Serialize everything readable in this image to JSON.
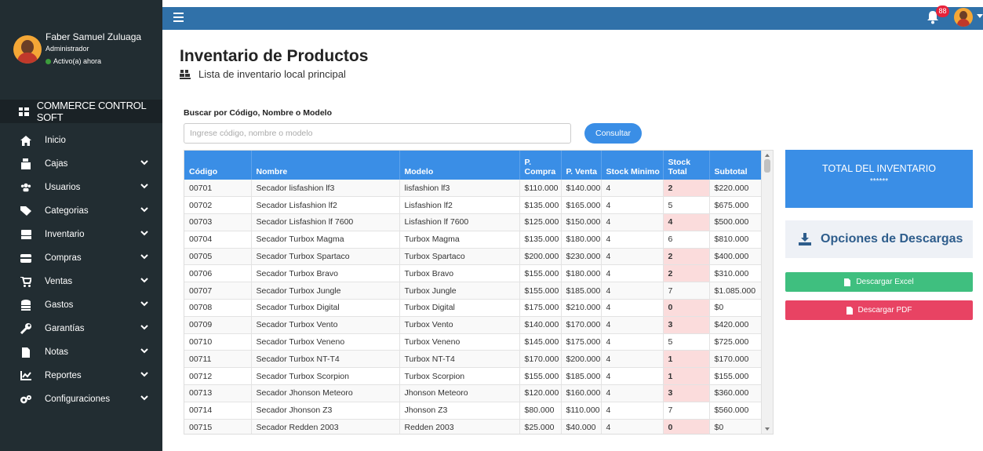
{
  "user": {
    "name": "Faber Samuel Zuluaga",
    "role": "Administrador",
    "status": "Activo(a) ahora"
  },
  "brand": "COMMERCE CONTROL SOFT",
  "menu": [
    {
      "label": "Inicio",
      "icon": "home-icon",
      "has_children": false
    },
    {
      "label": "Cajas",
      "icon": "cash-register-icon",
      "has_children": true
    },
    {
      "label": "Usuarios",
      "icon": "users-icon",
      "has_children": true
    },
    {
      "label": "Categorias",
      "icon": "tags-icon",
      "has_children": true
    },
    {
      "label": "Inventario",
      "icon": "pallet-icon",
      "has_children": true
    },
    {
      "label": "Compras",
      "icon": "wallet-icon",
      "has_children": true
    },
    {
      "label": "Ventas",
      "icon": "cart-icon",
      "has_children": true
    },
    {
      "label": "Gastos",
      "icon": "coins-icon",
      "has_children": true
    },
    {
      "label": "Garantías",
      "icon": "wrench-icon",
      "has_children": true
    },
    {
      "label": "Notas",
      "icon": "file-icon",
      "has_children": true
    },
    {
      "label": "Reportes",
      "icon": "chart-line-icon",
      "has_children": true
    },
    {
      "label": "Configuraciones",
      "icon": "cogs-icon",
      "has_children": true
    }
  ],
  "topbar": {
    "notification_count": "88"
  },
  "page": {
    "title": "Inventario de Productos",
    "subtitle": "Lista de inventario local principal"
  },
  "search": {
    "label": "Buscar por Código, Nombre o Modelo",
    "placeholder": "Ingrese código, nombre o modelo",
    "value": "",
    "button_label": "Consultar"
  },
  "table": {
    "columns": [
      {
        "label": "Código"
      },
      {
        "label": "Nombre"
      },
      {
        "label": "Modelo"
      },
      {
        "label": "P. Compra"
      },
      {
        "label": "P. Venta"
      },
      {
        "label": "Stock Minimo"
      },
      {
        "label": "Stock Total"
      },
      {
        "label": "Subtotal"
      }
    ],
    "rows": [
      {
        "codigo": "00701",
        "nombre": "Secador lisfashion lf3",
        "modelo": "lisfashion lf3",
        "compra": "$110.000",
        "venta": "$140.000",
        "minimo": "4",
        "total": "2",
        "subtotal": "$220.000",
        "low": true
      },
      {
        "codigo": "00702",
        "nombre": "Secador Lisfashion lf2",
        "modelo": "Lisfashion lf2",
        "compra": "$135.000",
        "venta": "$165.000",
        "minimo": "4",
        "total": "5",
        "subtotal": "$675.000",
        "low": false
      },
      {
        "codigo": "00703",
        "nombre": "Secador Lisfashion lf 7600",
        "modelo": "Lisfashion lf 7600",
        "compra": "$125.000",
        "venta": "$150.000",
        "minimo": "4",
        "total": "4",
        "subtotal": "$500.000",
        "low": true
      },
      {
        "codigo": "00704",
        "nombre": "Secador Turbox Magma",
        "modelo": "Turbox Magma",
        "compra": "$135.000",
        "venta": "$180.000",
        "minimo": "4",
        "total": "6",
        "subtotal": "$810.000",
        "low": false
      },
      {
        "codigo": "00705",
        "nombre": "Secador Turbox Spartaco",
        "modelo": "Turbox Spartaco",
        "compra": "$200.000",
        "venta": "$230.000",
        "minimo": "4",
        "total": "2",
        "subtotal": "$400.000",
        "low": true
      },
      {
        "codigo": "00706",
        "nombre": "Secador Turbox Bravo",
        "modelo": "Turbox Bravo",
        "compra": "$155.000",
        "venta": "$180.000",
        "minimo": "4",
        "total": "2",
        "subtotal": "$310.000",
        "low": true
      },
      {
        "codigo": "00707",
        "nombre": "Secador Turbox Jungle",
        "modelo": "Turbox Jungle",
        "compra": "$155.000",
        "venta": "$185.000",
        "minimo": "4",
        "total": "7",
        "subtotal": "$1.085.000",
        "low": false
      },
      {
        "codigo": "00708",
        "nombre": "Secador Turbox Digital",
        "modelo": "Turbox Digital",
        "compra": "$175.000",
        "venta": "$210.000",
        "minimo": "4",
        "total": "0",
        "subtotal": "$0",
        "low": true
      },
      {
        "codigo": "00709",
        "nombre": "Secador Turbox Vento",
        "modelo": "Turbox Vento",
        "compra": "$140.000",
        "venta": "$170.000",
        "minimo": "4",
        "total": "3",
        "subtotal": "$420.000",
        "low": true
      },
      {
        "codigo": "00710",
        "nombre": "Secador Turbox Veneno",
        "modelo": "Turbox Veneno",
        "compra": "$145.000",
        "venta": "$175.000",
        "minimo": "4",
        "total": "5",
        "subtotal": "$725.000",
        "low": false
      },
      {
        "codigo": "00711",
        "nombre": "Secador Turbox NT-T4",
        "modelo": "Turbox NT-T4",
        "compra": "$170.000",
        "venta": "$200.000",
        "minimo": "4",
        "total": "1",
        "subtotal": "$170.000",
        "low": true
      },
      {
        "codigo": "00712",
        "nombre": "Secador Turbox Scorpion",
        "modelo": "Turbox Scorpion",
        "compra": "$155.000",
        "venta": "$185.000",
        "minimo": "4",
        "total": "1",
        "subtotal": "$155.000",
        "low": true
      },
      {
        "codigo": "00713",
        "nombre": "Secador Jhonson Meteoro",
        "modelo": "Jhonson Meteoro",
        "compra": "$120.000",
        "venta": "$160.000",
        "minimo": "4",
        "total": "3",
        "subtotal": "$360.000",
        "low": true
      },
      {
        "codigo": "00714",
        "nombre": "Secador Jhonson Z3",
        "modelo": "Jhonson Z3",
        "compra": "$80.000",
        "venta": "$110.000",
        "minimo": "4",
        "total": "7",
        "subtotal": "$560.000",
        "low": false
      },
      {
        "codigo": "00715",
        "nombre": "Secador Redden 2003",
        "modelo": "Redden 2003",
        "compra": "$25.000",
        "venta": "$40.000",
        "minimo": "4",
        "total": "0",
        "subtotal": "$0",
        "low": true
      }
    ]
  },
  "summary": {
    "title": "TOTAL DEL INVENTARIO",
    "value": "******"
  },
  "downloads": {
    "title": "Opciones de Descargas",
    "excel_label": "Descargar Excel",
    "pdf_label": "Descargar PDF"
  },
  "colors": {
    "sidebar": "#222d32",
    "topbar": "#3071a9",
    "accent": "#3a8ee6",
    "excel": "#3fbf7f",
    "pdf": "#e84363",
    "low_stock": "#fbdcdc"
  }
}
